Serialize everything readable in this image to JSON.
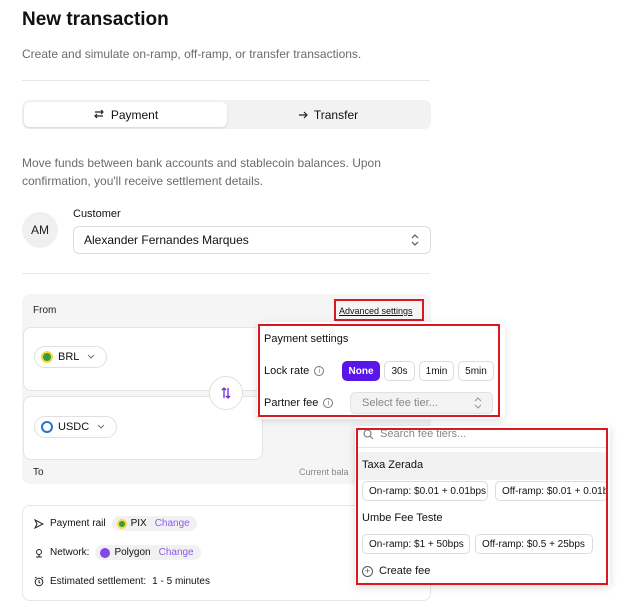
{
  "header": {
    "title": "New transaction",
    "subtitle": "Create and simulate on-ramp, off-ramp, or transfer transactions."
  },
  "mode_tabs": [
    {
      "label": "Payment",
      "icon": "arrows-swap-icon",
      "active": true
    },
    {
      "label": "Transfer",
      "icon": "arrow-right-icon",
      "active": false
    }
  ],
  "description": "Move funds between bank accounts and stablecoin balances. Upon confirmation, you'll receive settlement details.",
  "customer": {
    "avatar_initials": "AM",
    "label": "Customer",
    "selected": "Alexander Fernandes Marques"
  },
  "from_section": {
    "label": "From",
    "advanced_settings": "Advanced settings",
    "from_currency": "BRL",
    "to_currency": "USDC",
    "to_label": "To",
    "current_balance_label": "Current bala"
  },
  "payment_settings": {
    "title": "Payment settings",
    "lock_rate_label": "Lock rate",
    "lock_rate_options": [
      "None",
      "30s",
      "1min",
      "5min"
    ],
    "lock_rate_selected": "None",
    "partner_fee_label": "Partner fee",
    "partner_fee_placeholder": "Select fee tier..."
  },
  "fee_tiers": {
    "search_placeholder": "Search fee tiers...",
    "tiers": [
      {
        "name": "Taxa Zerada",
        "onramp": "On-ramp: $0.01 + 0.01bps",
        "offramp": "Off-ramp: $0.01 + 0.01b"
      },
      {
        "name": "Umbe Fee Teste",
        "onramp": "On-ramp: $1 + 50bps",
        "offramp": "Off-ramp: $0.5 + 25bps"
      }
    ],
    "create_label": "Create fee"
  },
  "details": {
    "payment_rail_label": "Payment rail",
    "payment_rail_value": "PIX",
    "network_label": "Network:",
    "network_value": "Polygon",
    "change_label": "Change",
    "settlement_label": "Estimated settlement:",
    "settlement_value": "1 - 5 minutes"
  },
  "colors": {
    "accent": "#5a16e8",
    "link_purple": "#8a5cf0",
    "annotation_red": "#d71920"
  }
}
